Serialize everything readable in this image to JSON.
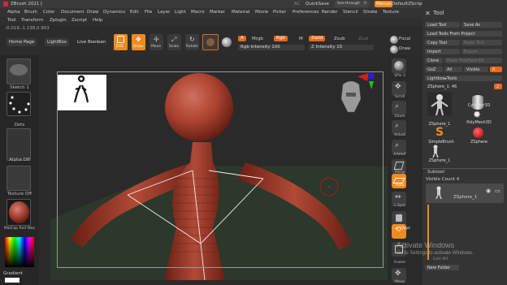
{
  "window": {
    "title": "ZBrush 2021 [",
    "ac": "AC",
    "quicksave": "QuickSave",
    "see_through": "See-through",
    "see_through_value": "0",
    "menus": "Menus",
    "default_script": "DefaultZScript"
  },
  "menubar": {
    "items": [
      "Alpha",
      "Brush",
      "Color",
      "Document",
      "Draw",
      "Dynamics",
      "Edit",
      "File",
      "Layer",
      "Light",
      "Macro",
      "Marker",
      "Material",
      "Movie",
      "Picker",
      "Preferences",
      "Render",
      "Stencil",
      "Stroke",
      "Texture"
    ],
    "items2": [
      "Tool",
      "Transform",
      "Zplugin",
      "Zscript",
      "Help"
    ]
  },
  "coords": "-0.019,-1.138,0.903",
  "toolbar": {
    "home_page": "Home Page",
    "lightbox": "LightBox",
    "live_boolean": "Live Boolean",
    "edit": "Edit",
    "draw": "Draw",
    "move": "Move",
    "scale": "Scale",
    "rotate": "Rotate",
    "a": "A",
    "mrgb": "Mrgb",
    "rgb": "Rgb",
    "m": "M",
    "zadd": "Zadd",
    "zsub": "Zsub",
    "zcut": "Zcut",
    "rgb_intensity": "Rgb Intensity 100",
    "z_intensity": "Z Intensity 15",
    "focal": "Focal",
    "draw_size": "Draw"
  },
  "left": {
    "sketch": "Sketch 1",
    "dots": "Dots",
    "alpha_off": "Alpha Off",
    "texture_off": "Texture Off",
    "matcap": "MatCap Red Wax",
    "gradient": "Gradient"
  },
  "rightcol": {
    "spix": "SPix 3",
    "scroll": "Scroll",
    "zoom": "Zoom",
    "actual": "Actual",
    "aahalf": "AAHalf",
    "persp": "Persp",
    "floor": "Floor",
    "l_sym": "L.Sym",
    "xyz": "Qxyz",
    "frame": "Frame",
    "move": "Move"
  },
  "toolpanel": {
    "title": "Tool",
    "load_tool": "Load Tool",
    "save_as": "Save As",
    "load_from_project": "Load Tools From Project",
    "copy_tool": "Copy Tool",
    "paste_tool": "Paste Tool",
    "import": "Import",
    "export": "Export",
    "clone": "Clone",
    "make_polymesh": "Make PolyMesh3D",
    "goz": "GoZ",
    "all": "All",
    "visible": "Visible",
    "r": "R",
    "lightbox_tools": "Lightbox▸Tools",
    "zsphere_name": "ZSphere_1. 46",
    "tools": [
      {
        "name": "ZSphere_1"
      },
      {
        "name": "Cylinder3D"
      },
      {
        "name": "PolyMesh3D"
      },
      {
        "name": "SimpleBrush"
      },
      {
        "name": "ZSphere"
      },
      {
        "name": "ZSphere_1"
      }
    ],
    "tools_count_label": "2",
    "subtool": "Subtool",
    "visible_count": "Visible Count 4",
    "subtool_item": "ZSphere_1",
    "list_all": "List All",
    "new_folder": "New Folder"
  },
  "watermark": {
    "line1": "Activate Windows",
    "line2": "Go to Settings to activate Windows."
  },
  "colors": {
    "accent": "#f08a1c",
    "model": "#a8402e",
    "zadd": "#e7681d"
  }
}
